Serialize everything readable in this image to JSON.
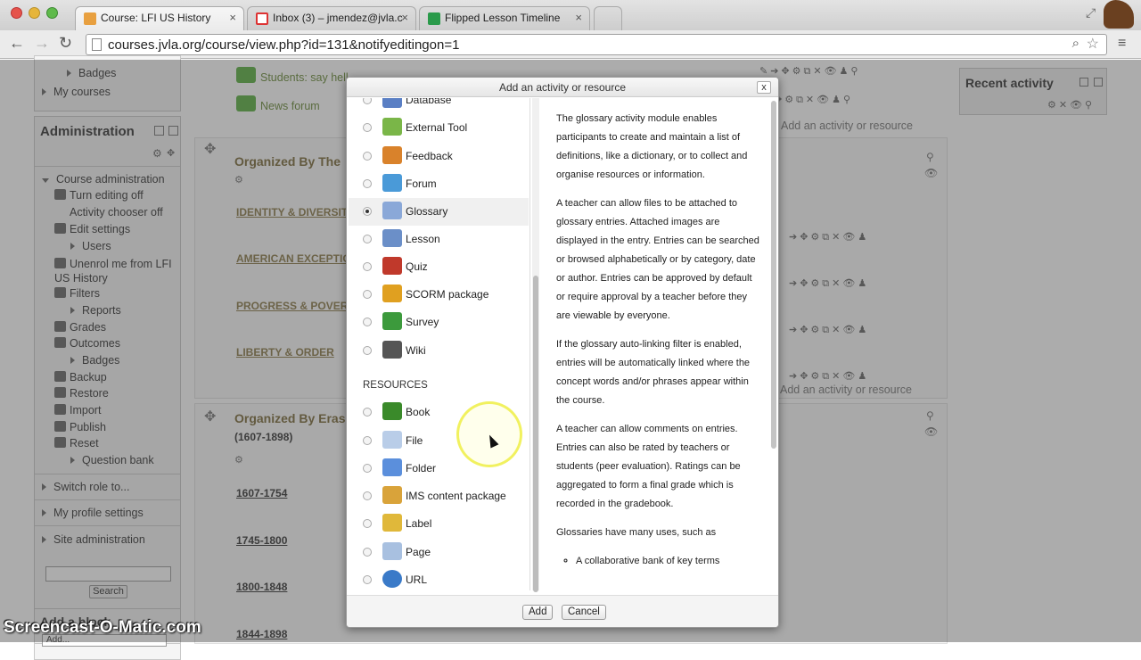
{
  "browser": {
    "tabs": [
      {
        "title": "Course: LFI US History",
        "active": true
      },
      {
        "title": "Inbox (3) – jmendez@jvla.c",
        "active": false
      },
      {
        "title": "Flipped Lesson Timeline",
        "active": false
      }
    ],
    "url": "courses.jvla.org/course/view.php?id=131&notifyeditingon=1"
  },
  "sidebar": {
    "top_items": [
      "Badges",
      "My courses"
    ],
    "admin_title": "Administration",
    "course_admin": "Course administration",
    "items": [
      "Turn editing off",
      "Activity chooser off",
      "Edit settings",
      "Users",
      "Unenrol me from LFI US History",
      "Filters",
      "Reports",
      "Grades",
      "Outcomes",
      "Badges",
      "Backup",
      "Restore",
      "Import",
      "Publish",
      "Reset",
      "Question bank"
    ],
    "switch_role": "Switch role to...",
    "profile_settings": "My profile settings",
    "site_admin": "Site administration",
    "search_button": "Search",
    "add_block": "Add a block",
    "add_select": "Add..."
  },
  "main": {
    "top_links": [
      "Students: say hell",
      "News forum"
    ],
    "sec1_title": "Organized By The",
    "sec1_links": [
      "IDENTITY & DIVERSIT",
      "AMERICAN EXCEPTIC",
      "PROGRESS & POVER",
      "LIBERTY & ORDER"
    ],
    "sec2_title": "Organized By Eras",
    "sec2_sub": "(1607-1898)",
    "sec2_links": [
      "1607-1754",
      "1745-1800",
      "1800-1848",
      "1844-1898"
    ],
    "add_activity": "Add an activity or resource"
  },
  "right": {
    "recent_activity": "Recent activity"
  },
  "dialog": {
    "title": "Add an activity or resource",
    "close": "x",
    "activities": [
      {
        "label": "Database",
        "icon": "database-icon",
        "color": "#5a7fc4"
      },
      {
        "label": "External Tool",
        "icon": "puzzle-icon",
        "color": "#7ab648"
      },
      {
        "label": "Feedback",
        "icon": "megaphone-icon",
        "color": "#d9822b"
      },
      {
        "label": "Forum",
        "icon": "forum-icon",
        "color": "#4a9ad8"
      },
      {
        "label": "Glossary",
        "icon": "glossary-icon",
        "color": "#8aa8d8",
        "selected": true
      },
      {
        "label": "Lesson",
        "icon": "lesson-icon",
        "color": "#6b8fc8"
      },
      {
        "label": "Quiz",
        "icon": "quiz-icon",
        "color": "#c0392b"
      },
      {
        "label": "SCORM package",
        "icon": "scorm-icon",
        "color": "#e0a020"
      },
      {
        "label": "Survey",
        "icon": "survey-icon",
        "color": "#3c9a3c"
      },
      {
        "label": "Wiki",
        "icon": "wiki-icon",
        "color": "#555555"
      }
    ],
    "resources_heading": "RESOURCES",
    "resources": [
      {
        "label": "Book",
        "icon": "book-icon",
        "color": "#3a8a2a"
      },
      {
        "label": "File",
        "icon": "file-icon",
        "color": "#b9cde8"
      },
      {
        "label": "Folder",
        "icon": "folder-icon",
        "color": "#5b8fdc"
      },
      {
        "label": "IMS content package",
        "icon": "package-icon",
        "color": "#d9a33a"
      },
      {
        "label": "Label",
        "icon": "label-icon",
        "color": "#e0b83a"
      },
      {
        "label": "Page",
        "icon": "page-icon",
        "color": "#a8c0e0"
      },
      {
        "label": "URL",
        "icon": "globe-icon",
        "color": "#3a7ac8"
      }
    ],
    "description": [
      "The glossary activity module enables participants to create and maintain a list of definitions, like a dictionary, or to collect and organise resources or information.",
      "A teacher can allow files to be attached to glossary entries. Attached images are displayed in the entry. Entries can be searched or browsed alphabetically or by category, date or author. Entries can be approved by default or require approval by a teacher before they are viewable by everyone.",
      "If the glossary auto-linking filter is enabled, entries will be automatically linked where the concept words and/or phrases appear within the course.",
      "A teacher can allow comments on entries. Entries can also be rated by teachers or students (peer evaluation). Ratings can be aggregated to form a final grade which is recorded in the gradebook.",
      "Glossaries have many uses, such as"
    ],
    "description_list": [
      "A collaborative bank of key terms"
    ],
    "add_button": "Add",
    "cancel_button": "Cancel"
  },
  "watermark": "Screencast-O-Matic.com"
}
